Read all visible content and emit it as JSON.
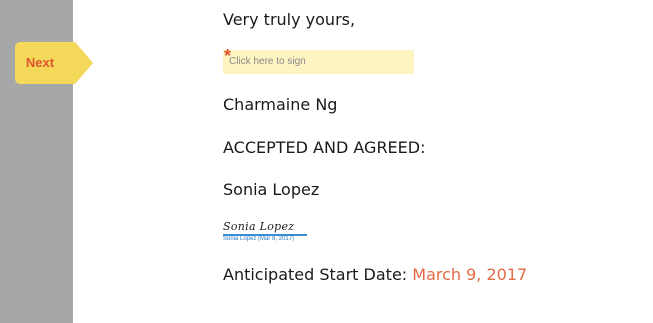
{
  "navigation": {
    "next_label": "Next"
  },
  "document": {
    "closing": "Very truly yours,",
    "sign_field": {
      "required_marker": "*",
      "placeholder": "Click here to sign"
    },
    "signer_name": "Charmaine Ng",
    "accepted_heading": "ACCEPTED AND AGREED:",
    "counterparty_name": "Sonia Lopez",
    "signature": {
      "script_text": "Sonia Lopez",
      "caption": "Sonia Lopez (Mar 8, 2017)"
    },
    "start_date_label": "Anticipated Start Date: ",
    "start_date_value": "March 9, 2017"
  },
  "colors": {
    "gutter": "#a7a7a7",
    "next_flag": "#f3d85a",
    "accent": "#e0542e",
    "sign_field_bg": "#fdf4c1",
    "signature_blue": "#2f7fc7"
  }
}
